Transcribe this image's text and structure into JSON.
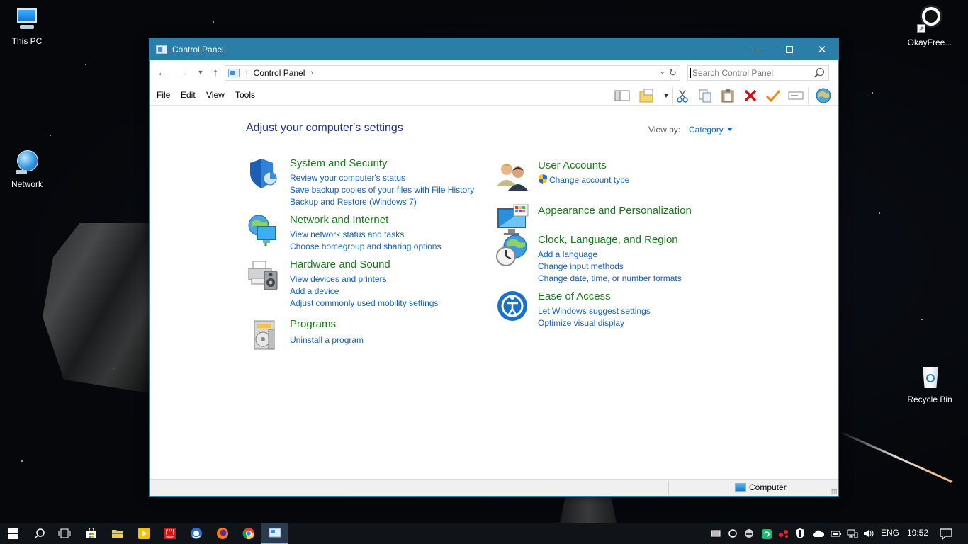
{
  "desktop": {
    "icons": [
      {
        "label": "This PC"
      },
      {
        "label": "Network"
      },
      {
        "label": "OkayFree..."
      },
      {
        "label": "Recycle Bin"
      }
    ]
  },
  "window": {
    "title": "Control Panel",
    "controls": {
      "minimize": "—",
      "maximize": "☐",
      "close": "✕"
    },
    "address": {
      "crumb": "Control Panel",
      "separator": "›"
    },
    "search": {
      "placeholder": "Search Control Panel"
    },
    "menu": {
      "file": "File",
      "edit": "Edit",
      "view": "View",
      "tools": "Tools"
    },
    "toolbar_icons": [
      "layout-icon",
      "new-folder-icon",
      "cut-icon",
      "copy-icon",
      "paste-icon",
      "delete-icon",
      "check-icon",
      "rename-icon",
      "globe-icon"
    ],
    "content": {
      "heading": "Adjust your computer's settings",
      "viewby_label": "View by:",
      "viewby_value": "Category",
      "categories": [
        {
          "title": "System and Security",
          "links": [
            "Review your computer's status",
            "Save backup copies of your files with File History",
            "Backup and Restore (Windows 7)"
          ]
        },
        {
          "title": "Network and Internet",
          "links": [
            "View network status and tasks",
            "Choose homegroup and sharing options"
          ]
        },
        {
          "title": "Hardware and Sound",
          "links": [
            "View devices and printers",
            "Add a device",
            "Adjust commonly used mobility settings"
          ]
        },
        {
          "title": "Programs",
          "links": [
            "Uninstall a program"
          ]
        },
        {
          "title": "User Accounts",
          "links": [
            "Change account type"
          ]
        },
        {
          "title": "Appearance and Personalization",
          "links": []
        },
        {
          "title": "Clock, Language, and Region",
          "links": [
            "Add a language",
            "Change input methods",
            "Change date, time, or number formats"
          ]
        },
        {
          "title": "Ease of Access",
          "links": [
            "Let Windows suggest settings",
            "Optimize visual display"
          ]
        }
      ]
    },
    "statusbar": {
      "location": "Computer"
    }
  },
  "taskbar": {
    "language": "ENG",
    "clock": "19:52"
  },
  "colors": {
    "titlebar": "#2b7ea8",
    "heading": "#1e3287",
    "category_title": "#1a7a1a",
    "link": "#1660b4",
    "taskbar": "#101318"
  }
}
